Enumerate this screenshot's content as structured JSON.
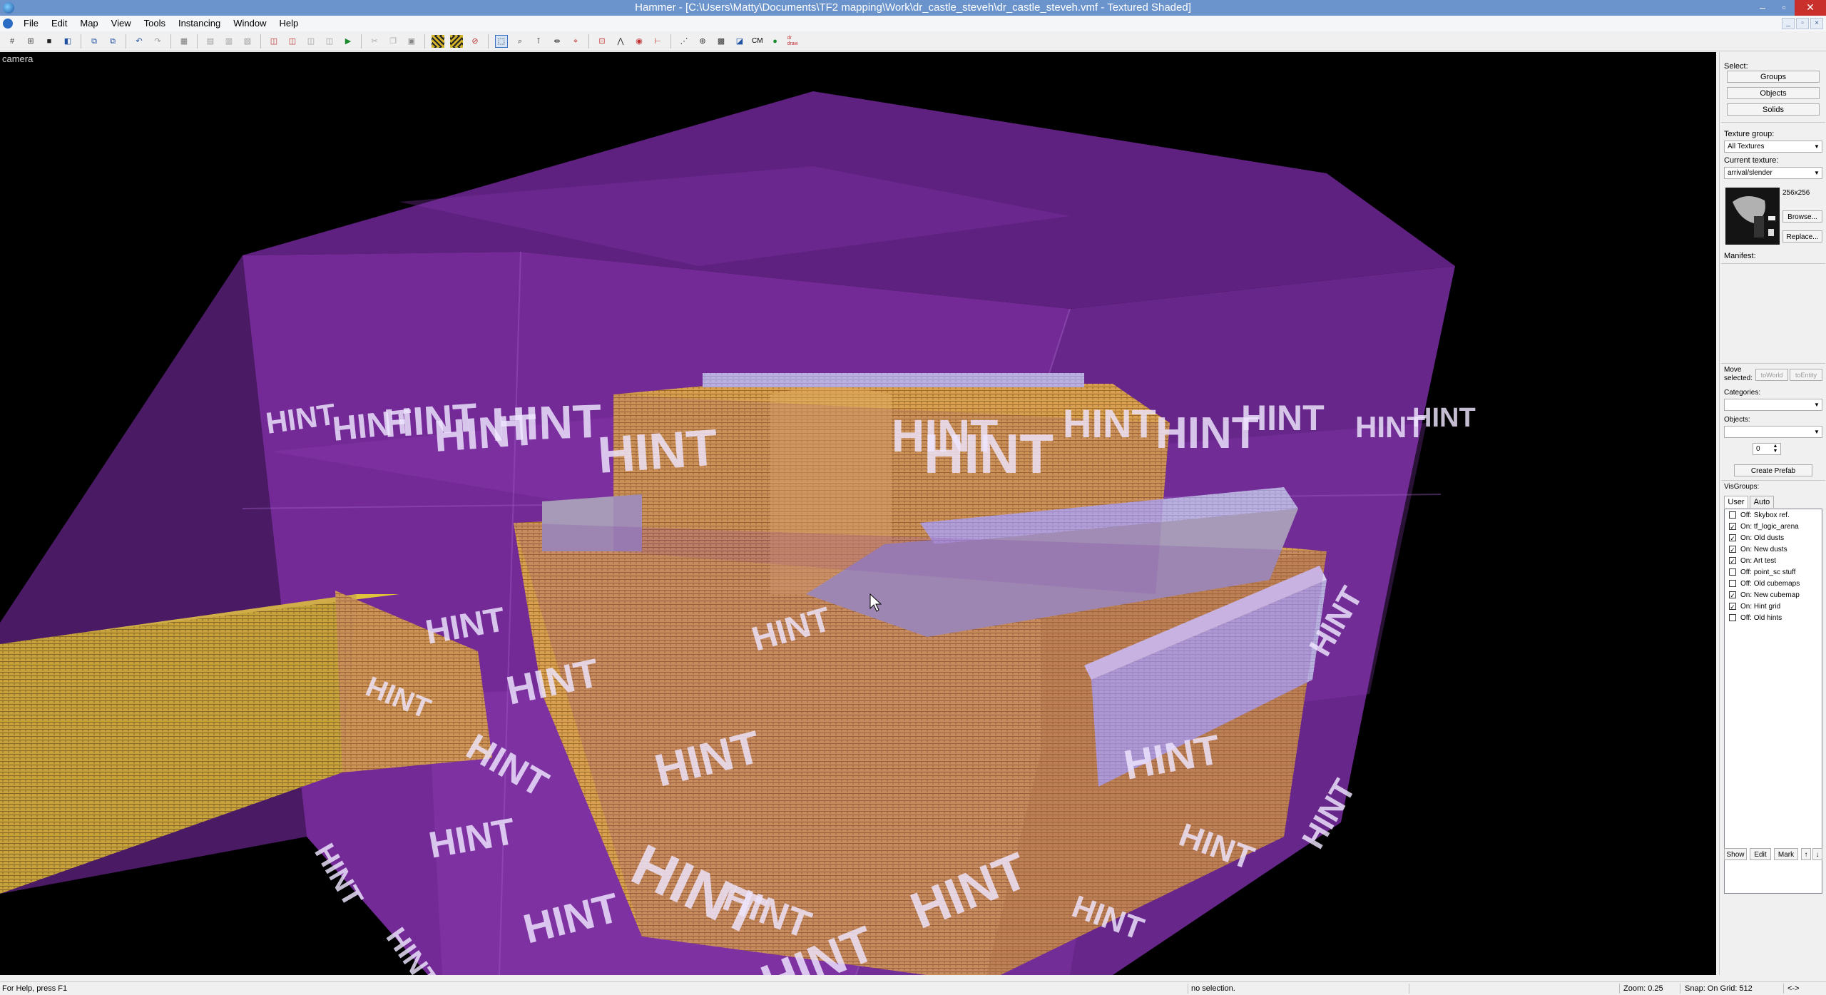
{
  "window": {
    "title": "Hammer - [C:\\Users\\Matty\\Documents\\TF2 mapping\\Work\\dr_castle_steveh\\dr_castle_steveh.vmf - Textured Shaded]",
    "controls": [
      "–",
      "▫",
      "✕"
    ],
    "mdi_controls": [
      "_",
      "▫",
      "×"
    ]
  },
  "menu": [
    "File",
    "Edit",
    "Map",
    "View",
    "Tools",
    "Instancing",
    "Window",
    "Help"
  ],
  "toolbar": {
    "cm_label": "CM",
    "draw_label": "dr\ndraw"
  },
  "viewport": {
    "label": "camera",
    "hint_texts": [
      "HINT",
      "HINT",
      "HINT",
      "HINT",
      "HINT",
      "HINT",
      "HINT",
      "HINT",
      "HINT",
      "HINT",
      "HINT",
      "HINT",
      "HINT",
      "HINT",
      "HINT",
      "HINT",
      "HINT",
      "HINT",
      "HINT",
      "HINT",
      "HINT",
      "HINT",
      "HINT",
      "HINT",
      "HINT",
      "HINT",
      "HINT",
      "HINT",
      "HINT",
      "HINT",
      "HINT",
      "HINT"
    ]
  },
  "panel": {
    "select_label": "Select:",
    "select_buttons": [
      "Groups",
      "Objects",
      "Solids"
    ],
    "texture_group_label": "Texture group:",
    "texture_group_value": "All Textures",
    "current_texture_label": "Current texture:",
    "current_texture_value": "arrival/slender",
    "texture_size": "256x256",
    "browse": "Browse...",
    "replace": "Replace...",
    "manifest_label": "Manifest:",
    "move_selected_label": "Move selected:",
    "to_world": "toWorld",
    "to_entity": "toEntity",
    "categories_label": "Categories:",
    "objects_label": "Objects:",
    "faces_value": "0",
    "create_prefab": "Create Prefab",
    "visgroups_label": "VisGroups:",
    "tabs": [
      "User",
      "Auto"
    ],
    "visgroups": [
      {
        "label": "Off: Skybox ref.",
        "checked": false
      },
      {
        "label": "On: tf_logic_arena",
        "checked": true
      },
      {
        "label": "On: Old dusts",
        "checked": true
      },
      {
        "label": "On: New dusts",
        "checked": true
      },
      {
        "label": "On: Art test",
        "checked": true
      },
      {
        "label": "Off: point_sc stuff",
        "checked": false
      },
      {
        "label": "Off: Old cubemaps",
        "checked": false
      },
      {
        "label": "On: New cubemap",
        "checked": true
      },
      {
        "label": "On: Hint grid",
        "checked": true
      },
      {
        "label": "Off: Old hints",
        "checked": false
      }
    ],
    "bottom_buttons": [
      "Show",
      "Edit",
      "Mark",
      "↑",
      "↓"
    ]
  },
  "status": {
    "help": "For Help, press F1",
    "selection": "no selection.",
    "zoom": "Zoom: 0.25",
    "snap": "Snap: On Grid: 512",
    "arrows": "<->"
  },
  "colors": {
    "title_bar": "#6b93cc",
    "hint_purple": "#7a2a9c",
    "brick_orange": "#d69a4a",
    "yellow_beam": "#d4b42a",
    "lavender": "#b9aee0"
  }
}
